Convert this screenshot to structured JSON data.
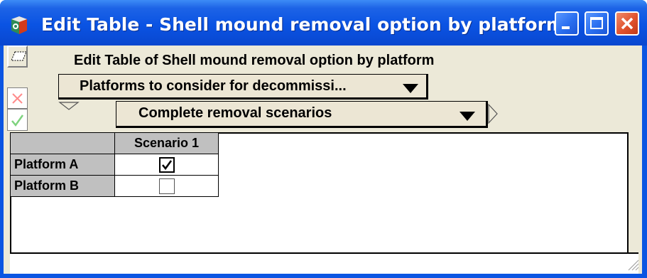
{
  "window": {
    "title": "Edit Table - Shell mound removal option by platform",
    "colors": {
      "titlebar": "#0a53e3",
      "client": "#ece9d8",
      "close": "#e0522e"
    }
  },
  "toolbar": {
    "heading": "Edit Table of Shell mound removal option by platform"
  },
  "dropdowns": {
    "index1": {
      "label": "Platforms to consider for decommissi..."
    },
    "index2": {
      "label": "Complete removal scenarios"
    }
  },
  "table": {
    "columns": [
      "Scenario 1"
    ],
    "rows": [
      {
        "label": "Platform A",
        "checked": true
      },
      {
        "label": "Platform B",
        "checked": false
      }
    ]
  },
  "icons": [
    "app-icon",
    "minimize-icon",
    "maximize-icon",
    "close-icon",
    "edit-table-icon",
    "cancel-x-icon",
    "ok-check-icon",
    "expand-triangle-icon",
    "pivot-right-arrow-icon",
    "dropdown-arrow-icon",
    "resize-grip-icon"
  ]
}
